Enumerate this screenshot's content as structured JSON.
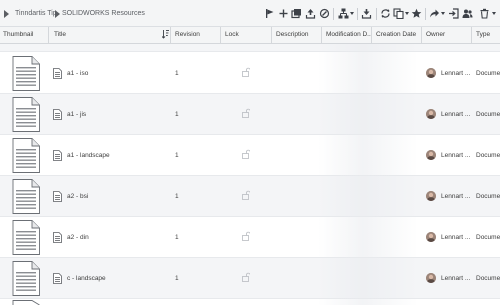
{
  "breadcrumb": {
    "items": [
      "Tinndartis Tip",
      "SOLIDWORKS Resources"
    ]
  },
  "toolbar": {
    "icons": [
      "flag-icon",
      "plus-icon",
      "collection-icon",
      "upload-icon",
      "link-icon",
      "hierarchy-icon",
      "download-icon",
      "sync-icon",
      "copy-icon",
      "star-icon",
      "share-icon",
      "enter-icon",
      "users-icon",
      "trash-icon"
    ]
  },
  "table": {
    "columns": {
      "thumbnail": "Thumbnail",
      "title": "Title",
      "revision": "Revision",
      "lock": "Lock",
      "description": "Description",
      "modification_date": "Modification D...",
      "creation_date": "Creation Date",
      "owner": "Owner",
      "type": "Type"
    },
    "rows": [
      {
        "title": "a1 - iso",
        "revision": "1",
        "owner": "Lennart ...",
        "type": "Document"
      },
      {
        "title": "a1 - jis",
        "revision": "1",
        "owner": "Lennart ...",
        "type": "Document"
      },
      {
        "title": "a1 - landscape",
        "revision": "1",
        "owner": "Lennart ...",
        "type": "Document"
      },
      {
        "title": "a2 - bsi",
        "revision": "1",
        "owner": "Lennart ...",
        "type": "Document"
      },
      {
        "title": "a2 - din",
        "revision": "1",
        "owner": "Lennart ...",
        "type": "Document"
      },
      {
        "title": "c - landscape",
        "revision": "1",
        "owner": "Lennart ...",
        "type": "Document"
      }
    ]
  },
  "colors": {
    "toolbar_bg": "#f4f5f6",
    "row_alt_bg": "#f4f5f7",
    "icon_color": "#3d4148"
  }
}
